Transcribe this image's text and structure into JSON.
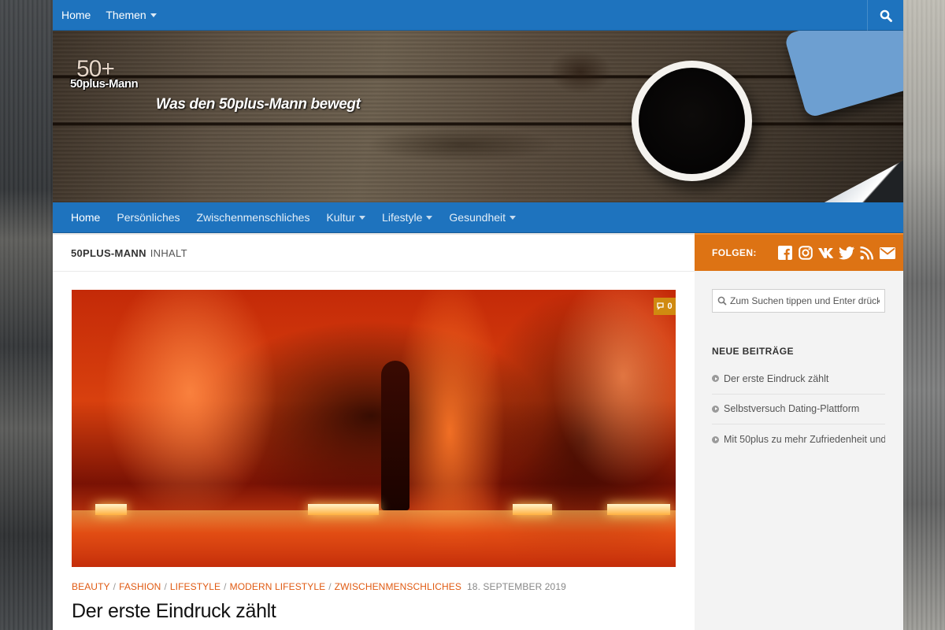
{
  "topnav": {
    "items": [
      {
        "label": "Home"
      },
      {
        "label": "Themen"
      }
    ]
  },
  "header": {
    "logo_top": "50+",
    "logo_bottom": "50plus-Mann",
    "tagline": "Was den 50plus-Mann bewegt"
  },
  "mainnav": {
    "items": [
      {
        "label": "Home"
      },
      {
        "label": "Persönliches"
      },
      {
        "label": "Zwischenmenschliches"
      },
      {
        "label": "Kultur"
      },
      {
        "label": "Lifestyle"
      },
      {
        "label": "Gesundheit"
      }
    ]
  },
  "content": {
    "heading_strong": "50plus-Mann",
    "heading_muted": "Inhalt",
    "comment_count": "0",
    "categories": [
      "Beauty",
      "Fashion",
      "Lifestyle",
      "Modern Lifestyle",
      "Zwischenmenschliches"
    ],
    "date": "18. September 2019",
    "post_title": "Der erste Eindruck zählt"
  },
  "sidebar": {
    "follow_label": "FOLGEN:",
    "search_placeholder": "Zum Suchen tippen und Enter drücken",
    "widget_title": "Neue Beiträge",
    "recent_posts": [
      "Der erste Eindruck zählt",
      "Selbstversuch Dating-Plattform",
      "Mit 50plus zu mehr Zufriedenheit und"
    ]
  },
  "colors": {
    "nav_blue": "#1e73be",
    "accent_orange": "#dd7314",
    "category_orange": "#e05a12"
  }
}
